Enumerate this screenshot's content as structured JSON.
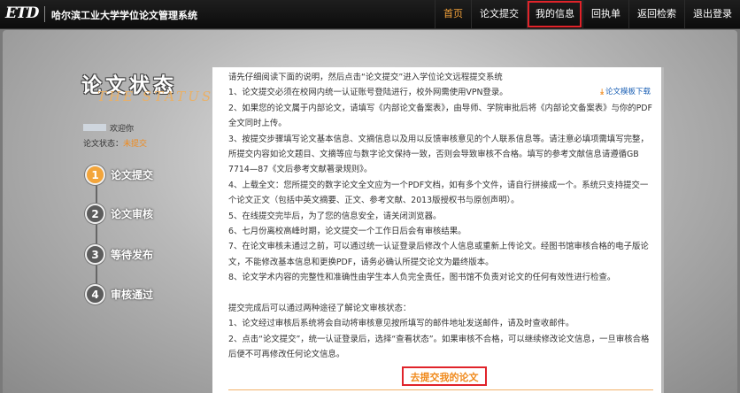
{
  "header": {
    "logo": "ETD",
    "title": "哈尔滨工业大学学位论文管理系统",
    "nav": [
      "首页",
      "论文提交",
      "我的信息",
      "回执单",
      "返回检索",
      "退出登录"
    ]
  },
  "sidebar": {
    "title": "论文状态",
    "subtitle": "THE STATUS",
    "welcome": "欢迎你",
    "status_label": "论文状态：",
    "status_value": "未提交",
    "steps": [
      {
        "num": "1",
        "label": "论文提交"
      },
      {
        "num": "2",
        "label": "论文审核"
      },
      {
        "num": "3",
        "label": "等待发布"
      },
      {
        "num": "4",
        "label": "审核通过"
      }
    ]
  },
  "content": {
    "download_label": "论文模板下载",
    "lines": [
      "请先仔细阅读下面的说明，然后点击“论文提交”进入学位论文远程提交系统",
      "1、论文提交必须在校网内统一认证账号登陆进行，校外网需使用VPN登录。",
      "2、如果您的论文属于内部论文，请填写《内部论文备案表》，由导师、学院审批后将《内部论文备案表》与你的PDF全文同时上传。",
      "3、按提交步骤填写论文基本信息、文摘信息以及用以反馈审核意见的个人联系信息等。请注意必填项需填写完整，所提交内容如论文题目、文摘等应与数字论文保持一致，否则会导致审核不合格。填写的参考文献信息请遵循GB 7714—87《文后参考文献著录规则》。",
      "4、上载全文：您所提交的数字论文全文应为一个PDF文档，如有多个文件，请自行拼接成一个。系统只支持提交一个论文正文（包括中英文摘要、正文、参考文献、2013版授权书与原创声明）。",
      "5、在线提交完毕后，为了您的信息安全，请关闭浏览器。",
      "6、七月份离校高峰时期，论文提交一个工作日后会有审核结果。",
      "7、在论文审核未通过之前，可以通过统一认证登录后修改个人信息或重新上传论文。经图书馆审核合格的电子版论文，不能修改基本信息和更换PDF，请务必确认所提交论文为最终版本。",
      "8、论文学术内容的完整性和准确性由学生本人负完全责任，图书馆不负责对论文的任何有效性进行检查。"
    ],
    "lines2": [
      "提交完成后可以通过两种途径了解论文审核状态：",
      "1、论文经过审核后系统将会自动将审核意见按所填写的邮件地址发送邮件，请及时查收邮件。",
      "2、点击“论文提交”，统一认证登录后，选择“查看状态”。如果审核不合格，可以继续修改论文信息，一旦审核合格后便不可再修改任何论文信息。"
    ],
    "submit_label": "去提交我的论文"
  },
  "colors": {
    "accent": "#f08a1c",
    "highlight": "#e0232a",
    "link": "#1a5fb4"
  }
}
